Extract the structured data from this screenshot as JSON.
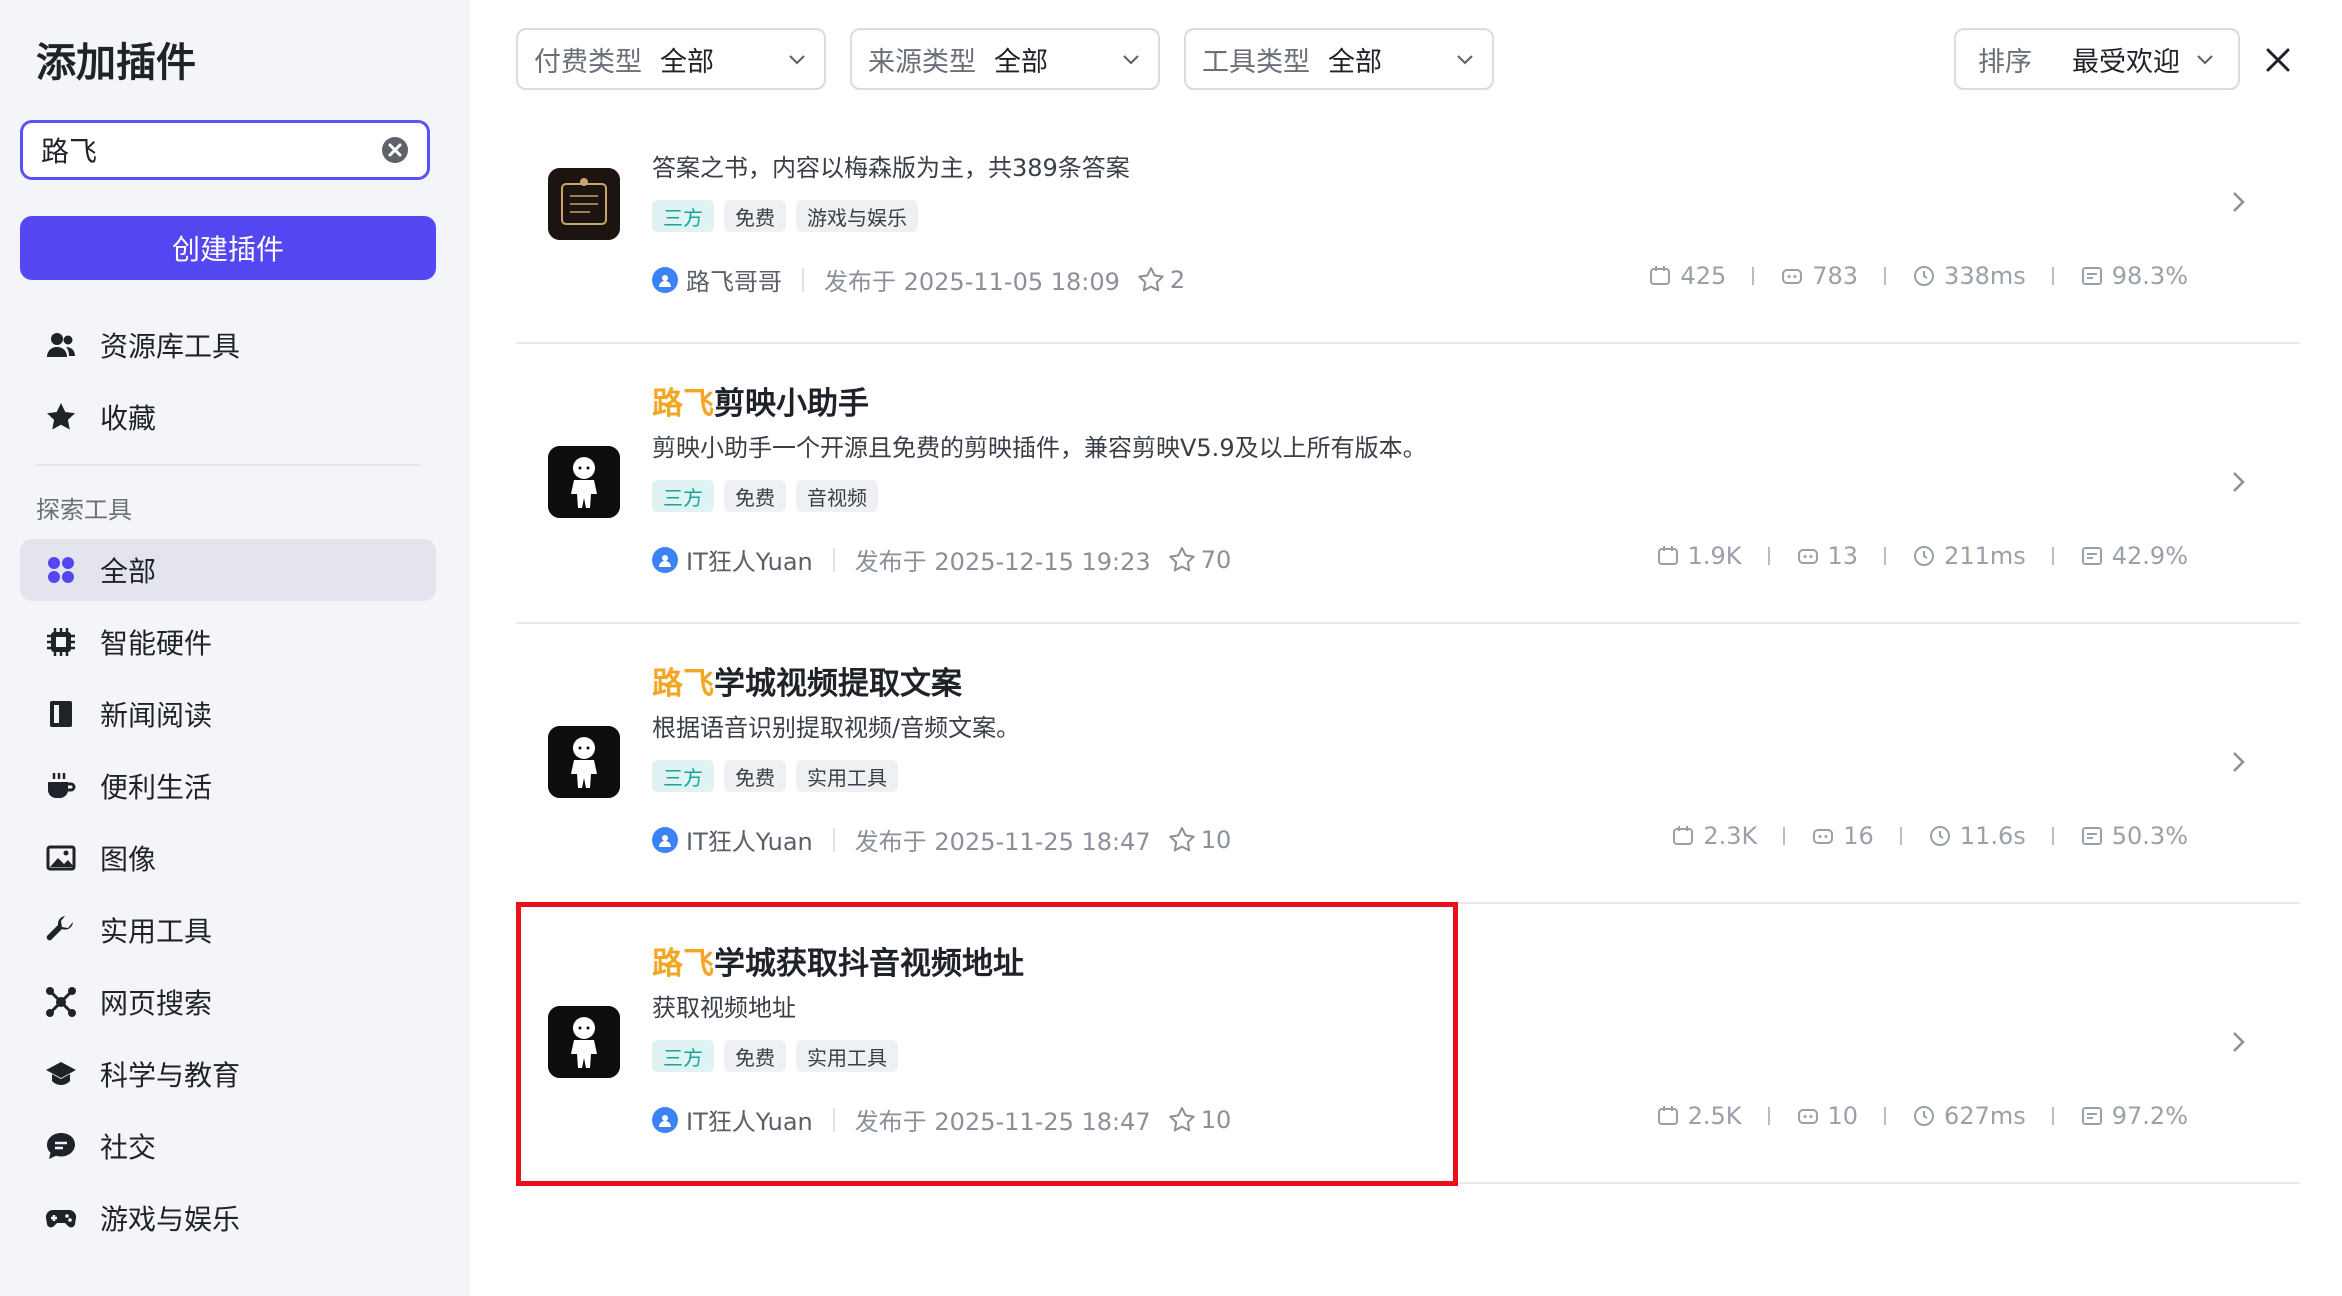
{
  "sidebar": {
    "title": "添加插件",
    "search_value": "路飞",
    "create_button": "创建插件",
    "top_items": [
      {
        "label": "资源库工具",
        "icon": "users-icon"
      },
      {
        "label": "收藏",
        "icon": "star-icon"
      }
    ],
    "section_label": "探索工具",
    "items": [
      {
        "label": "全部",
        "icon": "grid-icon",
        "active": true
      },
      {
        "label": "智能硬件",
        "icon": "chip-icon"
      },
      {
        "label": "新闻阅读",
        "icon": "book-icon"
      },
      {
        "label": "便利生活",
        "icon": "coffee-icon"
      },
      {
        "label": "图像",
        "icon": "image-icon"
      },
      {
        "label": "实用工具",
        "icon": "wrench-icon"
      },
      {
        "label": "网页搜索",
        "icon": "network-icon"
      },
      {
        "label": "科学与教育",
        "icon": "graduation-cap-icon"
      },
      {
        "label": "社交",
        "icon": "chat-icon"
      },
      {
        "label": "游戏与娱乐",
        "icon": "gamepad-icon"
      }
    ]
  },
  "filters": [
    {
      "key": "付费类型",
      "value": "全部"
    },
    {
      "key": "来源类型",
      "value": "全部"
    },
    {
      "key": "工具类型",
      "value": "全部"
    }
  ],
  "sort": {
    "key": "排序",
    "value": "最受欢迎"
  },
  "cards": [
    {
      "title_prefix": "",
      "title_rest": "",
      "description": "答案之书，内容以梅森版为主，共389条答案",
      "tags": [
        "三方",
        "免费",
        "游戏与娱乐"
      ],
      "author": "路飞哥哥",
      "published": "发布于 2025-11-05 18:09",
      "stars": "2",
      "stat_calls": "425",
      "stat_bots": "783",
      "stat_latency": "338ms",
      "stat_success": "98.3%",
      "logo": "book-of-answers-logo"
    },
    {
      "title_prefix": "路飞",
      "title_rest": "剪映小助手",
      "description": "剪映小助手一个开源且免费的剪映插件，兼容剪映V5.9及以上所有版本。",
      "tags": [
        "三方",
        "免费",
        "音视频"
      ],
      "author": "IT狂人Yuan",
      "published": "发布于 2025-12-15 19:23",
      "stars": "70",
      "stat_calls": "1.9K",
      "stat_bots": "13",
      "stat_latency": "211ms",
      "stat_success": "42.9%",
      "logo": "character-logo"
    },
    {
      "title_prefix": "路飞",
      "title_rest": "学城视频提取文案",
      "description": "根据语音识别提取视频/音频文案。",
      "tags": [
        "三方",
        "免费",
        "实用工具"
      ],
      "author": "IT狂人Yuan",
      "published": "发布于 2025-11-25 18:47",
      "stars": "10",
      "stat_calls": "2.3K",
      "stat_bots": "16",
      "stat_latency": "11.6s",
      "stat_success": "50.3%",
      "logo": "character-logo"
    },
    {
      "title_prefix": "路飞",
      "title_rest": "学城获取抖音视频地址",
      "description": "获取视频地址",
      "tags": [
        "三方",
        "免费",
        "实用工具"
      ],
      "author": "IT狂人Yuan",
      "published": "发布于 2025-11-25 18:47",
      "stars": "10",
      "stat_calls": "2.5K",
      "stat_bots": "10",
      "stat_latency": "627ms",
      "stat_success": "97.2%",
      "logo": "character-logo"
    }
  ],
  "colors": {
    "accent": "#5447f2",
    "highlight": "#e8101b",
    "title_highlight": "#f5a623",
    "source_tag": "#17a39a"
  }
}
